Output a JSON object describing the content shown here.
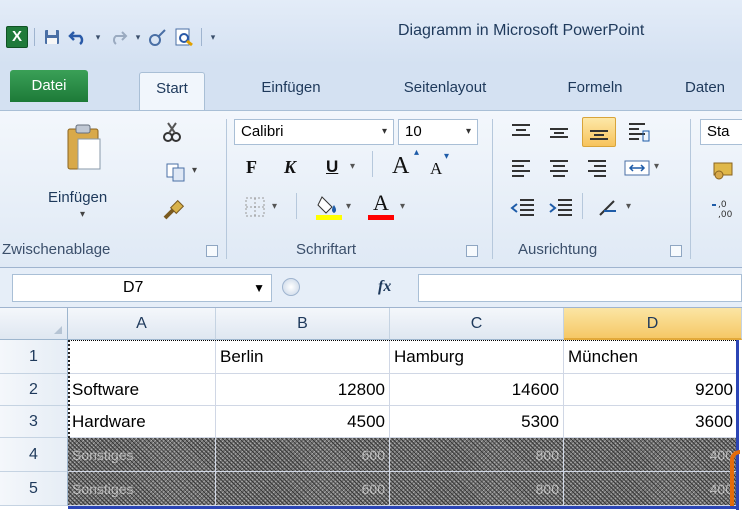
{
  "window": {
    "title": "Diagramm in Microsoft PowerPoint"
  },
  "quick_access": {
    "app_icon": "excel-icon",
    "items": [
      "save-icon",
      "undo-icon",
      "redo-icon",
      "format-painter-icon",
      "print-preview-icon",
      "customize-icon"
    ]
  },
  "tabs": [
    {
      "label": "Datei"
    },
    {
      "label": "Start"
    },
    {
      "label": "Einfügen"
    },
    {
      "label": "Seitenlayout"
    },
    {
      "label": "Formeln"
    },
    {
      "label": "Daten"
    }
  ],
  "ribbon": {
    "clipboard": {
      "paste_label": "Einfügen",
      "group_label": "Zwischenablage"
    },
    "font": {
      "font_name": "Calibri",
      "font_size": "10",
      "bold": "F",
      "italic": "K",
      "underline": "U",
      "grow": "A",
      "shrink": "A",
      "font_color_letter": "A",
      "group_label": "Schriftart"
    },
    "alignment": {
      "group_label": "Ausrichtung"
    },
    "styles_partial": "Sta"
  },
  "formula_bar": {
    "name_box": "D7",
    "fx_label": "fx",
    "formula": ""
  },
  "sheet": {
    "columns": [
      "A",
      "B",
      "C",
      "D"
    ],
    "selected_column": "D",
    "rows": [
      {
        "num": "1",
        "cells": [
          "",
          "Berlin",
          "Hamburg",
          "München"
        ]
      },
      {
        "num": "2",
        "cells": [
          "Software",
          "12800",
          "14600",
          "9200"
        ]
      },
      {
        "num": "3",
        "cells": [
          "Hardware",
          "4500",
          "5300",
          "3600"
        ]
      },
      {
        "num": "4",
        "cells": [
          "Sonstiges",
          "600",
          "800",
          "400"
        ]
      },
      {
        "num": "5",
        "cells": [
          "Sonstiges",
          "600",
          "800",
          "400"
        ]
      }
    ]
  },
  "colors": {
    "file_tab": "#2a8c46",
    "selected_column": "#f5c866",
    "range_border": "#2b45b5",
    "handle": "#e36c0a",
    "font_underline_highlight": "#ffff00",
    "font_color": "#ff0000"
  }
}
